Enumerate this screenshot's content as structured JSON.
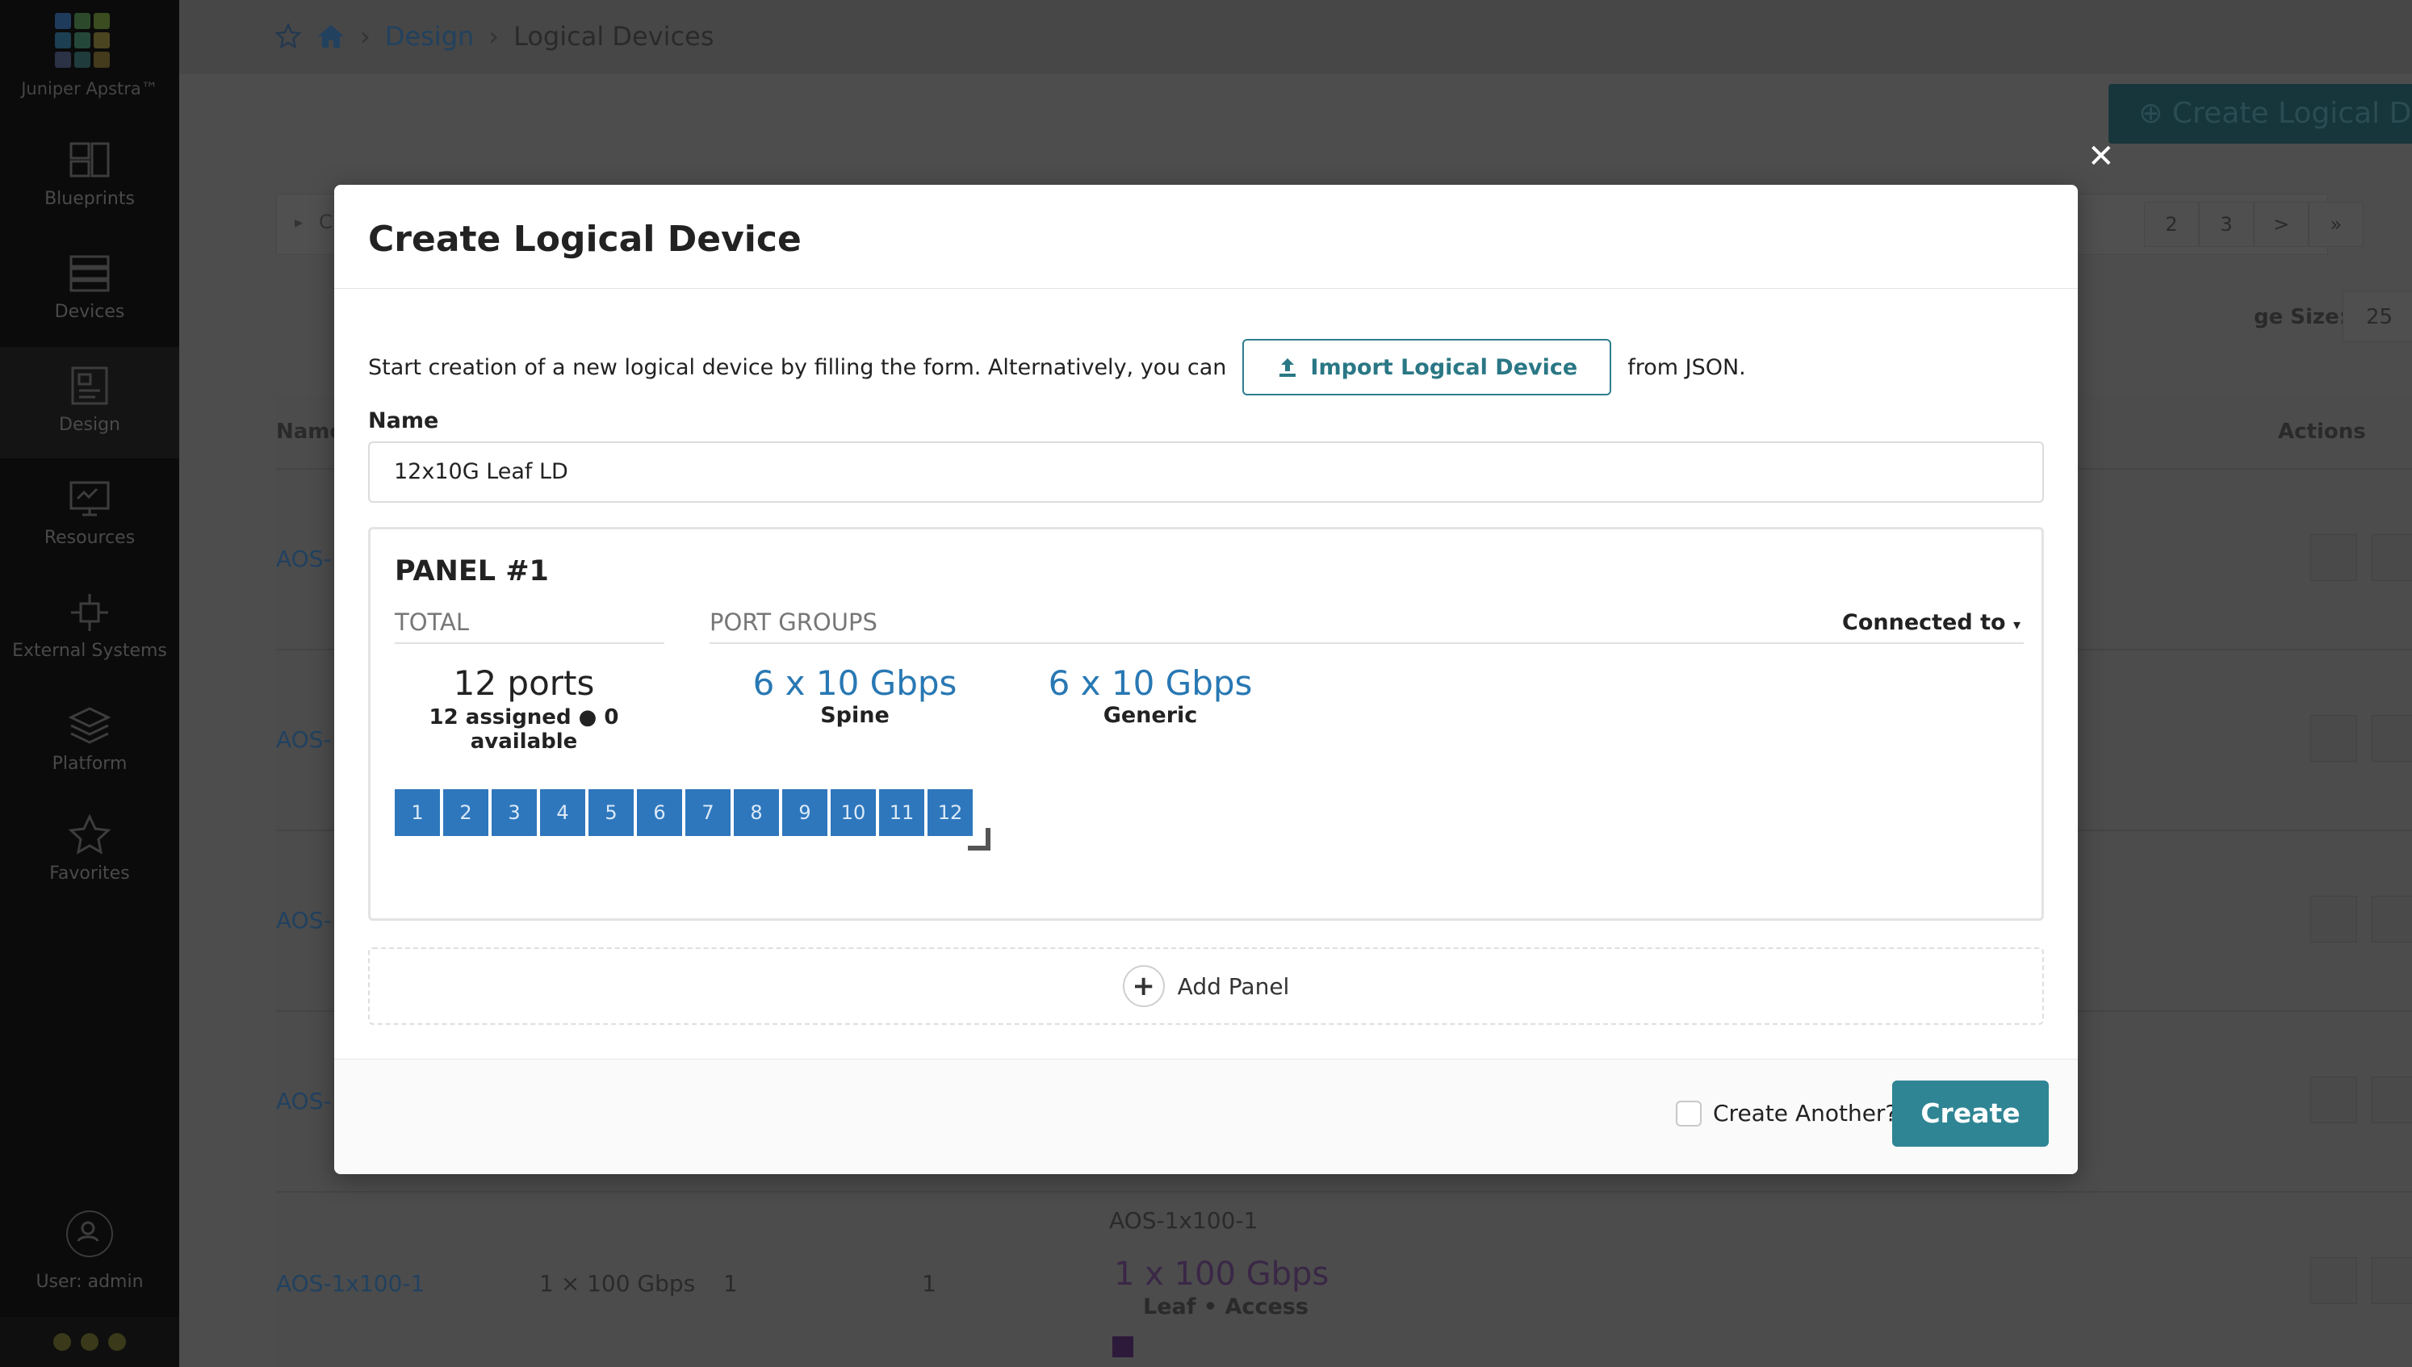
{
  "app": {
    "logo_text": "Juniper Apstra™",
    "logo_colors": [
      "#1f3b5c",
      "#2c4a2b",
      "#3a4c20",
      "#1c3f52",
      "#24473a",
      "#4a4420",
      "#2b3246",
      "#1f3b3b",
      "#443a1c"
    ]
  },
  "sidebar": {
    "items": [
      {
        "label": "Blueprints",
        "icon": "blueprints-icon"
      },
      {
        "label": "Devices",
        "icon": "devices-icon"
      },
      {
        "label": "Design",
        "icon": "design-icon"
      },
      {
        "label": "Resources",
        "icon": "resources-icon"
      },
      {
        "label": "External Systems",
        "icon": "external-systems-icon"
      },
      {
        "label": "Platform",
        "icon": "platform-icon"
      },
      {
        "label": "Favorites",
        "icon": "star-icon"
      }
    ],
    "user": "User: admin"
  },
  "breadcrumb": {
    "design": "Design",
    "current": "Logical Devices"
  },
  "background": {
    "create_button": "Create Logical Device",
    "pager": [
      "2",
      "3",
      ">",
      "»"
    ],
    "page_size_label": "ge Size:",
    "page_size_value": "25",
    "columns": {
      "name": "Name",
      "actions": "Actions"
    },
    "rows": [
      "AOS-",
      "AOS-",
      "AOS-",
      "AOS-"
    ],
    "last_row": {
      "name": "AOS-1x100-1",
      "speed": "1 × 100 Gbps",
      "col3": "1",
      "col4": "1",
      "ld_name": "AOS-1x100-1",
      "ld_speed": "1 x 100 Gbps",
      "ld_role": "Leaf • Access"
    },
    "filter_stub": "C"
  },
  "modal": {
    "title": "Create Logical Device",
    "intro_before": "Start creation of a new logical device by filling the form. Alternatively, you can",
    "import_label": "Import Logical Device",
    "intro_after": "from JSON.",
    "name_label": "Name",
    "name_value": "12x10G Leaf LD",
    "panel": {
      "title": "PANEL #1",
      "total_header": "TOTAL",
      "groups_header": "PORT GROUPS",
      "connected_to": "Connected to",
      "ports_total": "12 ports",
      "ports_status": "12 assigned ● 0 available",
      "groups": [
        {
          "speed": "6 x 10 Gbps",
          "role": "Spine"
        },
        {
          "speed": "6 x 10 Gbps",
          "role": "Generic"
        }
      ],
      "ports": [
        "1",
        "2",
        "3",
        "4",
        "5",
        "6",
        "7",
        "8",
        "9",
        "10",
        "11",
        "12"
      ]
    },
    "add_panel": "Add Panel",
    "create_another": "Create Another?",
    "create_button": "Create"
  },
  "colors": {
    "accent": "#2f8594",
    "port_blue": "#2e77bd",
    "link_blue": "#2878b3"
  }
}
